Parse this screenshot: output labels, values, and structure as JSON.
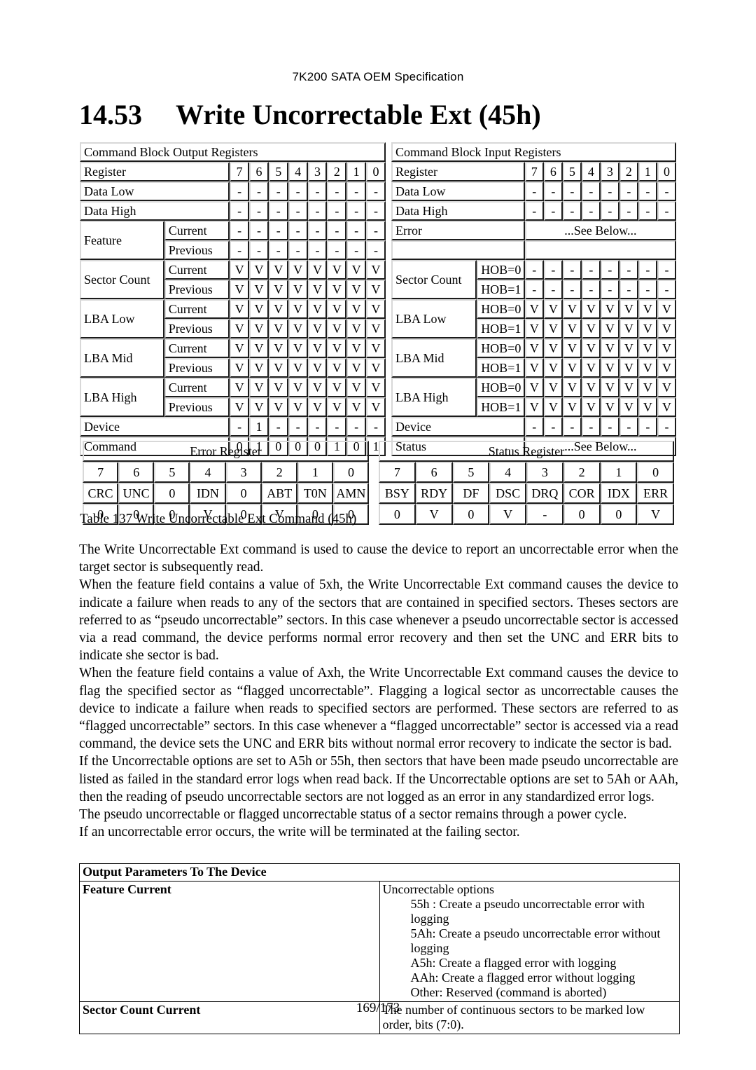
{
  "header": {
    "running_title": "7K200 SATA OEM Specification"
  },
  "section": {
    "number": "14.53",
    "title": "Write Uncorrectable Ext (45h)"
  },
  "output_registers": {
    "caption": "Command Block Output Registers",
    "bit_header_label": "Register",
    "bits": [
      "7",
      "6",
      "5",
      "4",
      "3",
      "2",
      "1",
      "0"
    ],
    "rows": [
      {
        "name": "Data Low",
        "sub": "",
        "values": [
          "-",
          "-",
          "-",
          "-",
          "-",
          "-",
          "-",
          "-"
        ]
      },
      {
        "name": "Data High",
        "sub": "",
        "values": [
          "-",
          "-",
          "-",
          "-",
          "-",
          "-",
          "-",
          "-"
        ]
      },
      {
        "name": "Feature",
        "sub": "Current",
        "values": [
          "-",
          "-",
          "-",
          "-",
          "-",
          "-",
          "-",
          "-"
        ]
      },
      {
        "name": "",
        "sub": "Previous",
        "values": [
          "-",
          "-",
          "-",
          "-",
          "-",
          "-",
          "-",
          "-"
        ]
      },
      {
        "name": "Sector Count",
        "sub": "Current",
        "values": [
          "V",
          "V",
          "V",
          "V",
          "V",
          "V",
          "V",
          "V"
        ]
      },
      {
        "name": "",
        "sub": "Previous",
        "values": [
          "V",
          "V",
          "V",
          "V",
          "V",
          "V",
          "V",
          "V"
        ]
      },
      {
        "name": "LBA Low",
        "sub": "Current",
        "values": [
          "V",
          "V",
          "V",
          "V",
          "V",
          "V",
          "V",
          "V"
        ]
      },
      {
        "name": "",
        "sub": "Previous",
        "values": [
          "V",
          "V",
          "V",
          "V",
          "V",
          "V",
          "V",
          "V"
        ]
      },
      {
        "name": "LBA Mid",
        "sub": "Current",
        "values": [
          "V",
          "V",
          "V",
          "V",
          "V",
          "V",
          "V",
          "V"
        ]
      },
      {
        "name": "",
        "sub": "Previous",
        "values": [
          "V",
          "V",
          "V",
          "V",
          "V",
          "V",
          "V",
          "V"
        ]
      },
      {
        "name": "LBA High",
        "sub": "Current",
        "values": [
          "V",
          "V",
          "V",
          "V",
          "V",
          "V",
          "V",
          "V"
        ]
      },
      {
        "name": "",
        "sub": "Previous",
        "values": [
          "V",
          "V",
          "V",
          "V",
          "V",
          "V",
          "V",
          "V"
        ]
      },
      {
        "name": "Device",
        "sub": "",
        "values": [
          "-",
          "1",
          "-",
          "-",
          "-",
          "-",
          "-",
          "-"
        ]
      },
      {
        "name": "Command",
        "sub": "",
        "values": [
          "0",
          "1",
          "0",
          "0",
          "0",
          "1",
          "0",
          "1"
        ]
      }
    ]
  },
  "input_registers": {
    "caption": "Command Block Input Registers",
    "bit_header_label": "Register",
    "bits": [
      "7",
      "6",
      "5",
      "4",
      "3",
      "2",
      "1",
      "0"
    ],
    "see_below": "...See Below...",
    "rows": [
      {
        "name": "Data Low",
        "sub": "",
        "values": [
          "-",
          "-",
          "-",
          "-",
          "-",
          "-",
          "-",
          "-"
        ]
      },
      {
        "name": "Data High",
        "sub": "",
        "values": [
          "-",
          "-",
          "-",
          "-",
          "-",
          "-",
          "-",
          "-"
        ]
      },
      {
        "name": "Error",
        "sub": "",
        "span": "...See Below..."
      },
      {
        "name": "",
        "sub": "",
        "span": ""
      },
      {
        "name": "Sector Count",
        "sub": "HOB=0",
        "values": [
          "-",
          "-",
          "-",
          "-",
          "-",
          "-",
          "-",
          "-"
        ]
      },
      {
        "name": "",
        "sub": "HOB=1",
        "values": [
          "-",
          "-",
          "-",
          "-",
          "-",
          "-",
          "-",
          "-"
        ]
      },
      {
        "name": "LBA Low",
        "sub": "HOB=0",
        "values": [
          "V",
          "V",
          "V",
          "V",
          "V",
          "V",
          "V",
          "V"
        ]
      },
      {
        "name": "",
        "sub": "HOB=1",
        "values": [
          "V",
          "V",
          "V",
          "V",
          "V",
          "V",
          "V",
          "V"
        ]
      },
      {
        "name": "LBA Mid",
        "sub": "HOB=0",
        "values": [
          "V",
          "V",
          "V",
          "V",
          "V",
          "V",
          "V",
          "V"
        ]
      },
      {
        "name": "",
        "sub": "HOB=1",
        "values": [
          "V",
          "V",
          "V",
          "V",
          "V",
          "V",
          "V",
          "V"
        ]
      },
      {
        "name": "LBA High",
        "sub": "HOB=0",
        "values": [
          "V",
          "V",
          "V",
          "V",
          "V",
          "V",
          "V",
          "V"
        ]
      },
      {
        "name": "",
        "sub": "HOB=1",
        "values": [
          "V",
          "V",
          "V",
          "V",
          "V",
          "V",
          "V",
          "V"
        ]
      },
      {
        "name": "Device",
        "sub": "",
        "values": [
          "-",
          "-",
          "-",
          "-",
          "-",
          "-",
          "-",
          "-"
        ]
      },
      {
        "name": "Status",
        "sub": "",
        "span": "...See Below..."
      }
    ]
  },
  "error_register": {
    "title": "Error Register",
    "bits": [
      "7",
      "6",
      "5",
      "4",
      "3",
      "2",
      "1",
      "0"
    ],
    "names": [
      "CRC",
      "UNC",
      "0",
      "IDN",
      "0",
      "ABT",
      "T0N",
      "AMN"
    ],
    "values": [
      "0",
      "0",
      "0",
      "V",
      "0",
      "V",
      "0",
      "0"
    ]
  },
  "status_register": {
    "title": "Status Register",
    "bits": [
      "7",
      "6",
      "5",
      "4",
      "3",
      "2",
      "1",
      "0"
    ],
    "names": [
      "BSY",
      "RDY",
      "DF",
      "DSC",
      "DRQ",
      "COR",
      "IDX",
      "ERR"
    ],
    "values": [
      "0",
      "V",
      "0",
      "V",
      "-",
      "0",
      "0",
      "V"
    ]
  },
  "table_caption": "Table 137 Write Uncorrectable Ext Command (45h)",
  "body_paragraphs": [
    "The Write Uncorrectable Ext command is used to cause the device to report an uncorrectable error when the target sector is subsequently read.",
    "When the feature field contains a value of 5xh, the Write Uncorrectable Ext command causes the device to indicate a failure when reads to any of the sectors that are contained in specified sectors.  Theses sectors are referred to as “pseudo uncorrectable” sectors.  In this case whenever a pseudo uncorrectable sector is accessed via a read command, the device performs normal error recovery and then set the UNC and ERR bits to indicate she sector is bad.",
    "When the feature field contains a value of Axh, the Write Uncorrectable Ext command causes the device to flag the specified sector as “flagged uncorrectable”.  Flagging a logical sector as uncorrectable causes the device to indicate a failure when reads to specified sectors are performed.  These sectors are referred to as “flagged uncorrectable” sectors.  In this case whenever a “flagged uncorrectable” sector is accessed via a read command, the device sets the UNC and ERR bits without normal error recovery to indicate the sector is bad.",
    "If the Uncorrectable options are set to A5h or 55h, then sectors that have been made pseudo uncorrectable are listed as failed in the standard error logs when read back.  If the Uncorrectable options are set to 5Ah or AAh, then the reading of pseudo uncorrectable sectors are not logged as an error in any standardized error logs.",
    "The pseudo uncorrectable or flagged uncorrectable status of a sector remains through a power cycle.",
    "If an uncorrectable error occurs, the write will be terminated at the failing sector."
  ],
  "output_parameters": {
    "title": "Output Parameters To The Device",
    "feature_label": "Feature Current",
    "feature_intro": "Uncorrectable options",
    "feature_options": [
      "55h : Create a pseudo uncorrectable error with logging",
      "5Ah: Create a pseudo uncorrectable error without logging",
      "A5h: Create a flagged error with logging",
      "AAh: Create a flagged error without logging",
      "Other: Reserved (command is aborted)"
    ],
    "sector_count_label": "Sector Count Current",
    "sector_count_text": "The number of continuous sectors to be marked low order, bits (7:0)."
  },
  "footer": {
    "page": "169/173"
  }
}
